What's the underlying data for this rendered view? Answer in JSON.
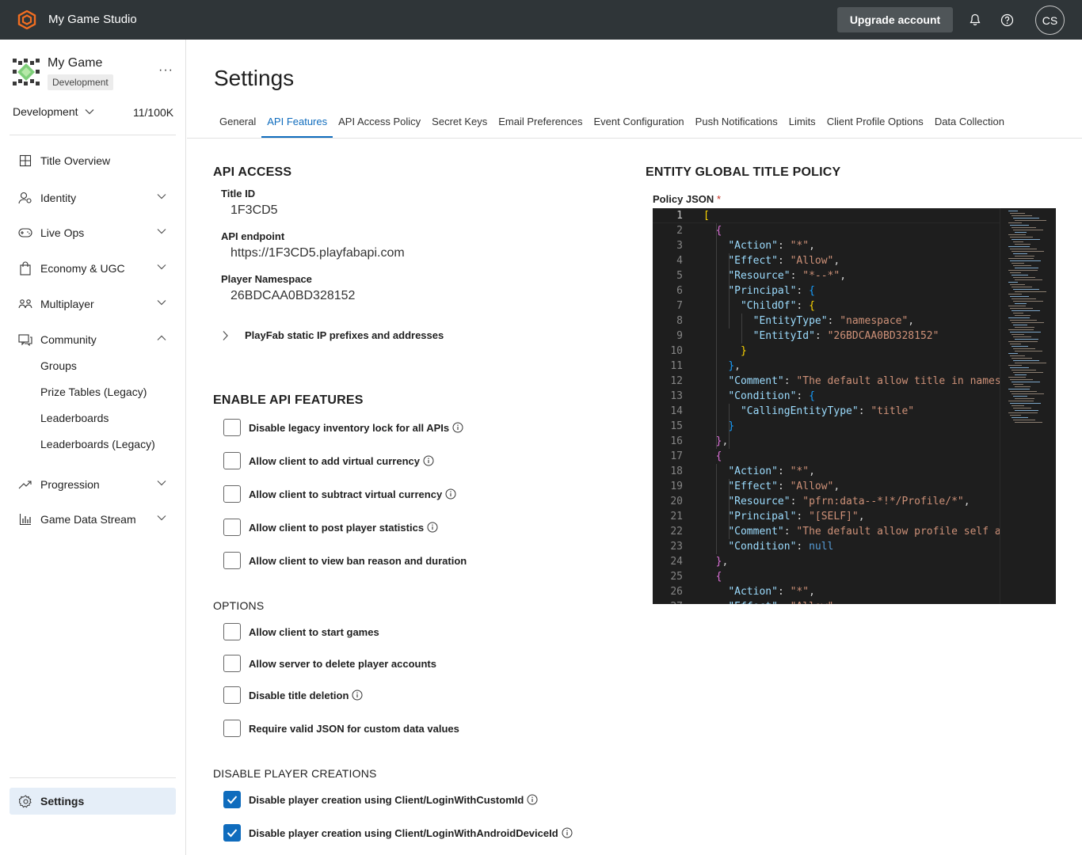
{
  "header": {
    "app_title": "My Game Studio",
    "upgrade_label": "Upgrade account",
    "avatar_initials": "CS",
    "brand_color": "#f26e21"
  },
  "sidebar": {
    "game_name": "My Game",
    "env_badge": "Development",
    "environment": "Development",
    "usage": "11/100K",
    "nav": [
      {
        "label": "Title Overview",
        "icon": "grid-icon"
      },
      {
        "label": "Identity",
        "icon": "identity-icon"
      },
      {
        "label": "Live Ops",
        "icon": "gamepad-icon"
      },
      {
        "label": "Economy & UGC",
        "icon": "shopping-bag-icon"
      },
      {
        "label": "Multiplayer",
        "icon": "multiplayer-icon"
      },
      {
        "label": "Community",
        "icon": "community-icon"
      },
      {
        "label": "Progression",
        "icon": "trend-up-icon"
      },
      {
        "label": "Game Data Stream",
        "icon": "bar-chart-icon"
      }
    ],
    "community_sub": [
      "Groups",
      "Prize Tables (Legacy)",
      "Leaderboards",
      "Leaderboards (Legacy)"
    ],
    "settings_label": "Settings"
  },
  "page": {
    "title": "Settings",
    "tabs": [
      "General",
      "API Features",
      "API Access Policy",
      "Secret Keys",
      "Email Preferences",
      "Event Configuration",
      "Push Notifications",
      "Limits",
      "Client Profile Options",
      "Data Collection"
    ],
    "active_tab": "API Features"
  },
  "api_access": {
    "heading": "API ACCESS",
    "title_id_label": "Title ID",
    "title_id": "1F3CD5",
    "endpoint_label": "API endpoint",
    "endpoint": "https://1F3CD5.playfabapi.com",
    "namespace_label": "Player Namespace",
    "namespace": "26BDCAA0BD328152",
    "ip_expander": "PlayFab static IP prefixes and addresses"
  },
  "enable_api_features": {
    "heading": "ENABLE API FEATURES",
    "items": [
      {
        "label": "Disable legacy inventory lock for all APIs",
        "checked": false,
        "info": true
      },
      {
        "label": "Allow client to add virtual currency",
        "checked": false,
        "info": true
      },
      {
        "label": "Allow client to subtract virtual currency",
        "checked": false,
        "info": true
      },
      {
        "label": "Allow client to post player statistics",
        "checked": false,
        "info": true
      },
      {
        "label": "Allow client to view ban reason and duration",
        "checked": false,
        "info": false
      }
    ]
  },
  "options": {
    "heading": "OPTIONS",
    "items": [
      {
        "label": "Allow client to start games",
        "checked": false,
        "info": false
      },
      {
        "label": "Allow server to delete player accounts",
        "checked": false,
        "info": false
      },
      {
        "label": "Disable title deletion",
        "checked": false,
        "info": true
      },
      {
        "label": "Require valid JSON for custom data values",
        "checked": false,
        "info": false
      }
    ]
  },
  "disable_player_creations": {
    "heading": "DISABLE PLAYER CREATIONS",
    "items": [
      {
        "label": "Disable player creation using Client/LoginWithCustomId",
        "checked": true,
        "info": true
      },
      {
        "label": "Disable player creation using Client/LoginWithAndroidDeviceId",
        "checked": true,
        "info": true
      }
    ]
  },
  "entity_policy": {
    "heading": "ENTITY GLOBAL TITLE POLICY",
    "policy_label": "Policy JSON",
    "required_mark": "*",
    "code_lines": [
      "[",
      "  {",
      "    \"Action\": \"*\",",
      "    \"Effect\": \"Allow\",",
      "    \"Resource\": \"*--*\",",
      "    \"Principal\": {",
      "      \"ChildOf\": {",
      "        \"EntityType\": \"namespace\",",
      "        \"EntityId\": \"26BDCAA0BD328152\"",
      "      }",
      "    },",
      "    \"Comment\": \"The default allow title in namesp",
      "    \"Condition\": {",
      "      \"CallingEntityType\": \"title\"",
      "    }",
      "  },",
      "  {",
      "    \"Action\": \"*\",",
      "    \"Effect\": \"Allow\",",
      "    \"Resource\": \"pfrn:data--*!*/Profile/*\",",
      "    \"Principal\": \"[SELF]\",",
      "    \"Comment\": \"The default allow profile self ac",
      "    \"Condition\": null",
      "  },",
      "  {",
      "    \"Action\": \"*\",",
      "    \"Effect\": \"Allow\","
    ]
  }
}
